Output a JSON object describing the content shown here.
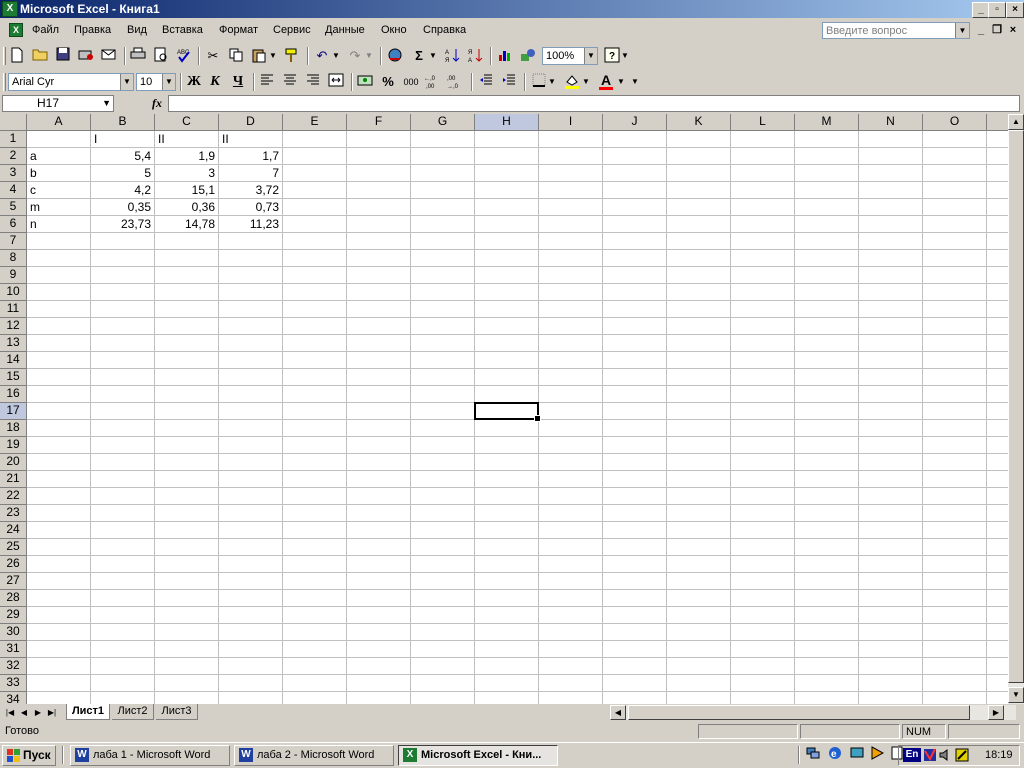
{
  "window": {
    "title": "Microsoft Excel - Книга1"
  },
  "menu": {
    "items": [
      "Файл",
      "Правка",
      "Вид",
      "Вставка",
      "Формат",
      "Сервис",
      "Данные",
      "Окно",
      "Справка"
    ],
    "help_placeholder": "Введите вопрос"
  },
  "toolbar": {
    "zoom": "100%"
  },
  "format_toolbar": {
    "font": "Arial Cyr",
    "size": "10",
    "bold": "Ж",
    "italic": "К",
    "underline": "Ч",
    "percent": "%",
    "thousands": "000",
    "font_color_letter": "A"
  },
  "formula_bar": {
    "name_box": "H17",
    "fx": "fx",
    "formula": ""
  },
  "sheet": {
    "columns": [
      "A",
      "B",
      "C",
      "D",
      "E",
      "F",
      "G",
      "H",
      "I",
      "J",
      "K",
      "L",
      "M",
      "N",
      "O"
    ],
    "row_count": 34,
    "selected_cell": "H17",
    "cells": {
      "B1": "I",
      "C1": "II",
      "D1": "II",
      "A2": "a",
      "B2": "5,4",
      "C2": "1,9",
      "D2": "1,7",
      "A3": "b",
      "B3": "5",
      "C3": "3",
      "D3": "7",
      "A4": "c",
      "B4": "4,2",
      "C4": "15,1",
      "D4": "3,72",
      "A5": "m",
      "B5": "0,35",
      "C5": "0,36",
      "D5": "0,73",
      "A6": "n",
      "B6": "23,73",
      "C6": "14,78",
      "D6": "11,23"
    }
  },
  "tabs": [
    "Лист1",
    "Лист2",
    "Лист3"
  ],
  "status": {
    "text": "Готово",
    "num": "NUM"
  },
  "taskbar": {
    "start": "Пуск",
    "buttons": [
      "лаба 1 - Microsoft Word",
      "лаба 2 - Microsoft Word",
      "Microsoft Excel - Кни..."
    ],
    "lang": "En",
    "clock": "18:19"
  }
}
